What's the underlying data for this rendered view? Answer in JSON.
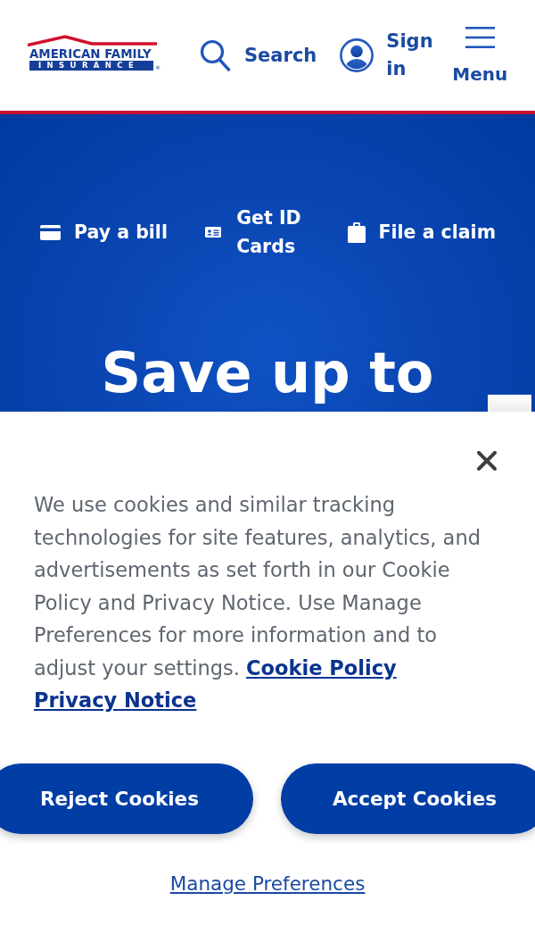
{
  "header": {
    "logo": {
      "wordmark": "AMERICAN FAMILY",
      "tagline": "INSURANCE",
      "registered": "®"
    },
    "actions": [
      {
        "kind": "search",
        "label": "Search"
      },
      {
        "kind": "account",
        "label": "Sign in"
      },
      {
        "kind": "menu",
        "label": "Menu"
      }
    ]
  },
  "hero": {
    "quick_links": [
      {
        "kind": "bill",
        "label": "Pay a bill"
      },
      {
        "kind": "id_card",
        "label": "Get ID Cards"
      },
      {
        "kind": "claim",
        "label": "File a claim"
      }
    ],
    "headline": "Save up to"
  },
  "cookie_banner": {
    "message": "We use cookies and similar tracking technologies for site features, analytics, and advertisements as set forth in our Cookie Policy and Privacy Notice. Use Manage Preferences for more information and to adjust your settings.",
    "links": [
      "Cookie Policy",
      "Privacy Notice"
    ],
    "buttons": [
      "Reject Cookies",
      "Accept Cookies"
    ],
    "manage_link": "Manage Preferences"
  }
}
